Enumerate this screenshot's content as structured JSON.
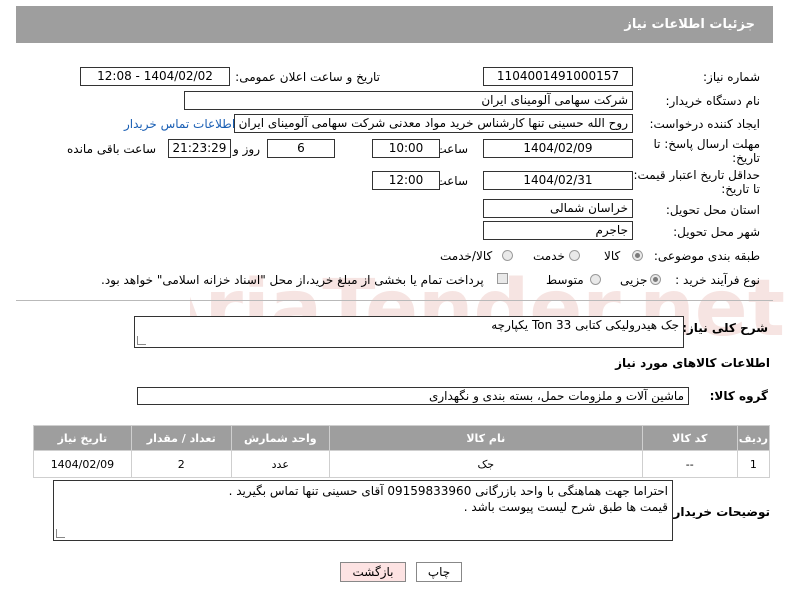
{
  "header": {
    "title": "جزئیات اطلاعات نیاز"
  },
  "form": {
    "need_number_label": "شماره نیاز:",
    "need_number": "1104001491000157",
    "announce_label": "تاریخ و ساعت اعلان عمومی:",
    "announce_value": "1404/02/02 - 12:08",
    "buyer_org_label": "نام دستگاه خریدار:",
    "buyer_org": "شرکت سهامی آلومینای ایران",
    "requester_label": "ایجاد کننده درخواست:",
    "requester": "روح الله حسینی تنها کارشناس خرید مواد معدنی شرکت سهامی آلومینای ایران",
    "contact_link": "اطلاعات تماس خریدار",
    "deadline_label_1": "مهلت ارسال پاسخ: تا",
    "deadline_label_2": "تاریخ:",
    "deadline_date": "1404/02/09",
    "time_label": "ساعت",
    "deadline_time": "10:00",
    "days_value": "6",
    "days_label": "روز و",
    "remaining_time": "21:23:29",
    "remaining_label": "ساعت باقی مانده",
    "validity_label_1": "حداقل تاریخ اعتبار قیمت:",
    "validity_label_2": "تا تاریخ:",
    "validity_date": "1404/02/31",
    "validity_time": "12:00",
    "province_label": "استان محل تحویل:",
    "province": "خراسان شمالی",
    "city_label": "شهر محل تحویل:",
    "city": "جاجرم",
    "category_label": "طبقه بندی موضوعی:",
    "category_options": [
      "کالا",
      "خدمت",
      "کالا/خدمت"
    ],
    "process_label": "نوع فرآیند خرید :",
    "process_options": [
      "جزیی",
      "متوسط"
    ],
    "payment_note": "پرداخت تمام یا بخشی از مبلغ خرید،از محل \"اسناد خزانه اسلامی\" خواهد بود."
  },
  "description": {
    "label": "شرح کلی نیاز:",
    "value": "جک هیدرولیکی کتابی 33 Ton یکپارچه"
  },
  "goods_info": {
    "title": "اطلاعات کالاهای مورد نیاز",
    "group_label": "گروه کالا:",
    "group_value": "ماشین آلات و ملزومات حمل، بسته بندی و نگهداری"
  },
  "table": {
    "headers": [
      "ردیف",
      "کد کالا",
      "نام کالا",
      "واحد شمارش",
      "تعداد / مقدار",
      "تاریخ نیاز"
    ],
    "rows": [
      [
        "1",
        "--",
        "جک",
        "عدد",
        "2",
        "1404/02/09"
      ]
    ]
  },
  "buyer_notes": {
    "label": "توضیحات خریدار:",
    "line1": "احتراما جهت هماهنگی با واحد بازرگانی 09159833960 آقای حسینی تنها تماس بگیرید .",
    "line2": "قیمت ها طبق شرح لیست پیوست باشد ."
  },
  "buttons": {
    "print": "چاپ",
    "back": "بازگشت"
  },
  "watermark": {
    "text": "AriaTender.net"
  },
  "colors": {
    "header_bg": "#9e9e9e",
    "link": "#1a5fb4",
    "back_btn_bg": "#fde3e3"
  }
}
